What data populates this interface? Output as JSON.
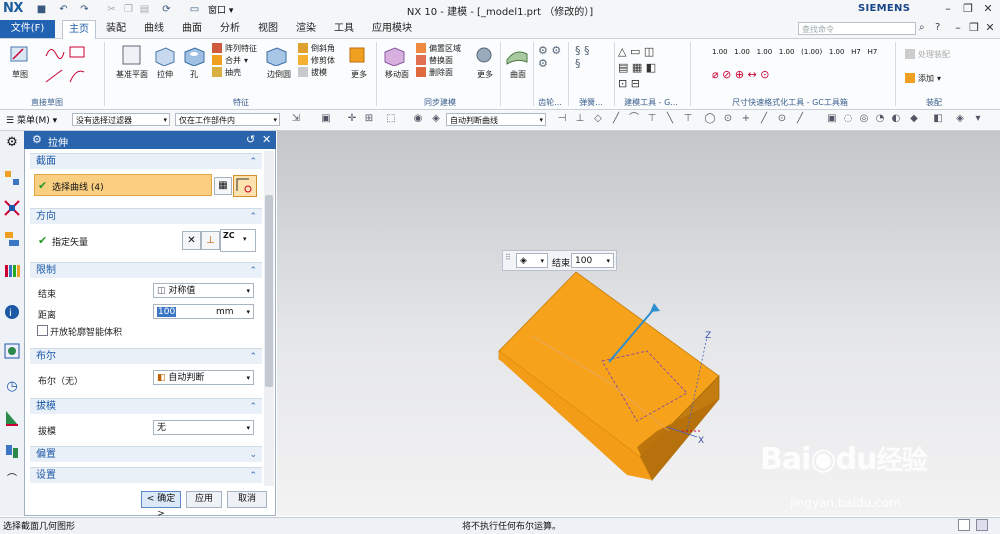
{
  "titlebar": {
    "logo": "NX",
    "window_menu": "窗口",
    "title": "NX 10 - 建模 - [_model1.prt （修改的）]",
    "brand": "SIEMENS",
    "min": "–",
    "restore": "❐",
    "close": "✕"
  },
  "menubar": {
    "file": "文件(F)",
    "tabs": [
      "主页",
      "装配",
      "曲线",
      "曲面",
      "分析",
      "视图",
      "渲染",
      "工具",
      "应用模块"
    ],
    "active_tab": "主页",
    "search_placeholder": "查找命令"
  },
  "ribbon": {
    "sketch": "草图",
    "group_direct_sketch": "直接草图",
    "datum_plane": "基准平面",
    "extrude": "拉伸",
    "hole": "孔",
    "pattern_feature": "阵列特征",
    "unite": "合并",
    "shell": "抽壳",
    "edge_blend": "边倒圆",
    "chamfer": "倒斜角",
    "trim_body": "修剪体",
    "draft": "拔模",
    "more": "更多",
    "group_feature": "特征",
    "move_face": "移动面",
    "offset_region": "偏置区域",
    "replace_face": "替换面",
    "delete_face": "删除面",
    "more2": "更多",
    "group_sync": "同步建模",
    "surface": "曲面",
    "group_gear": "齿轮...",
    "group_spring": "弹簧...",
    "group_modeling_tools": "建模工具 - G...",
    "group_dim_tools": "尺寸快速格式化工具 - GC工具箱",
    "dim_labels": [
      "1.00",
      "1.00",
      "1.00",
      "1.00",
      "(1.00)",
      "1.00",
      "H7",
      "H7"
    ],
    "process_assembly": "处理装配",
    "add": "添加",
    "group_assembly": "装配"
  },
  "toolbar2": {
    "menu": "菜单(M)",
    "filter": "没有选择过滤器",
    "scope": "仅在工作部件内",
    "curve_rule": "自动判断曲线"
  },
  "dialog": {
    "title": "拉伸",
    "sections": {
      "section": "截面",
      "select_curve": "选择曲线 (4)",
      "direction": "方向",
      "specify_vector": "指定矢量",
      "vector_label": "ZC",
      "limits": "限制",
      "end_label": "结束",
      "end_value": "对称值",
      "distance_label": "距离",
      "distance_value": "100",
      "distance_unit": "mm",
      "open_profile": "开放轮廓智能体积",
      "boolean": "布尔",
      "boolean_label": "布尔（无）",
      "boolean_value": "自动判断",
      "draft": "拔模",
      "draft_label": "拔模",
      "draft_value": "无",
      "offset": "偏置",
      "settings": "设置"
    },
    "ok": "< 确定 >",
    "apply": "应用",
    "cancel": "取消"
  },
  "viewport": {
    "onscreen_end_label": "结束",
    "onscreen_end_value": "100",
    "axis_z": "Z",
    "axis_x": "X"
  },
  "watermark": {
    "brand": "Bai",
    "brand2": "du",
    "brand_cn": "经验",
    "url": "jingyan.baidu.com"
  },
  "statusbar": {
    "left": "选择截面几何图形",
    "center": "将不执行任何布尔运算。"
  },
  "colors": {
    "accent": "#2262b3",
    "solid_top": "#f7a21b",
    "solid_front": "#f29b16",
    "solid_side": "#b9740d"
  }
}
